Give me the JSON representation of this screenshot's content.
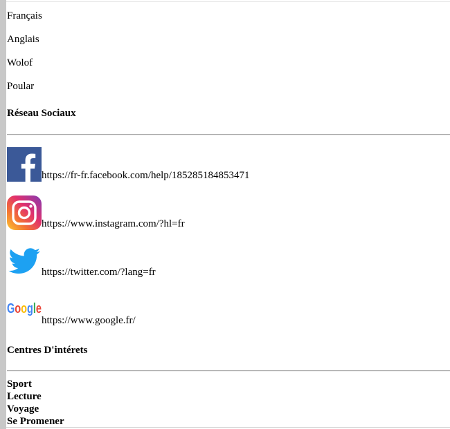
{
  "languages": [
    "Français",
    "Anglais",
    "Wolof",
    "Poular"
  ],
  "social_heading": "Réseau Sociaux",
  "social": [
    {
      "icon": "facebook-icon",
      "url": "https://fr-fr.facebook.com/help/185285184853471",
      "color": "#3b5998"
    },
    {
      "icon": "instagram-icon",
      "url": "https://www.instagram.com/?hl=fr",
      "color": "#c13584"
    },
    {
      "icon": "twitter-icon",
      "url": "https://twitter.com/?lang=fr",
      "color": "#1da1f2"
    },
    {
      "icon": "google-icon",
      "url": "https://www.google.fr/",
      "color": "#4285f4"
    }
  ],
  "interests_heading": "Centres D'intérets",
  "interests": [
    "Sport",
    "Lecture",
    "Voyage",
    "Se Promener"
  ]
}
